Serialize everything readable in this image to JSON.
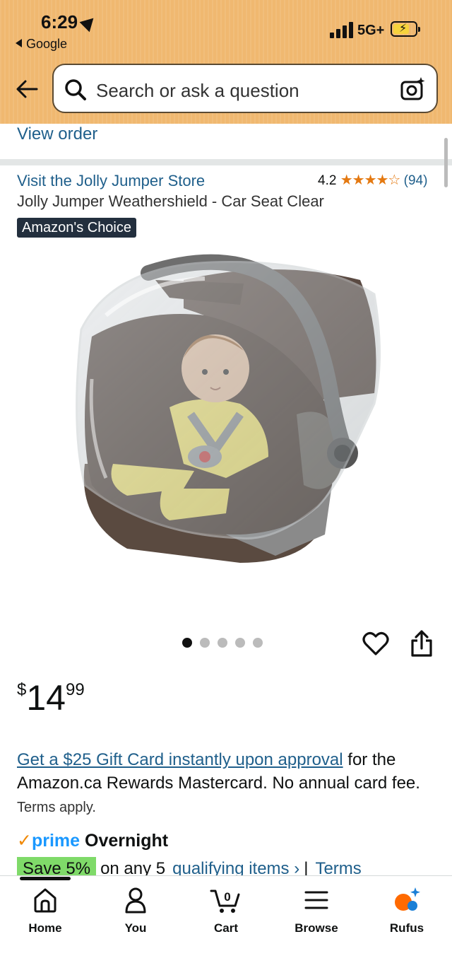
{
  "status_bar": {
    "time": "6:29",
    "back_app": "Google",
    "network": "5G+"
  },
  "search": {
    "placeholder": "Search or ask a question"
  },
  "order": {
    "view_order": "View order"
  },
  "product": {
    "store_link": "Visit the Jolly Jumper Store",
    "rating_value": "4.2",
    "rating_stars": "★★★★☆",
    "rating_count": "(94)",
    "title": "Jolly Jumper Weathershield - Car Seat Clear",
    "badge": "Amazon's Choice",
    "image_count": 5,
    "active_image_index": 0
  },
  "price": {
    "currency": "$",
    "whole": "14",
    "fraction": "99"
  },
  "offer": {
    "link_text": "Get a $25 Gift Card instantly upon approval",
    "text": " for the Amazon.ca Rewards Mastercard. No annual card fee. ",
    "terms": "Terms apply."
  },
  "delivery": {
    "prime_check": "✓",
    "prime_label": "prime",
    "speed": "Overnight"
  },
  "promo": {
    "save_label": "Save 5%",
    "text": "on any 5",
    "link1": "qualifying items ›",
    "separator": "|",
    "link2": "Terms"
  },
  "bottom_nav": {
    "items": [
      {
        "label": "Home",
        "icon": "home-icon"
      },
      {
        "label": "You",
        "icon": "person-icon"
      },
      {
        "label": "Cart",
        "icon": "cart-icon",
        "count": "0"
      },
      {
        "label": "Browse",
        "icon": "menu-icon"
      },
      {
        "label": "Rufus",
        "icon": "rufus-icon"
      }
    ]
  },
  "colors": {
    "header_bg": "#f0b870",
    "link": "#1f5f8b",
    "star": "#e47911",
    "prime_blue": "#1a98ff",
    "save_badge": "#7fda69"
  }
}
